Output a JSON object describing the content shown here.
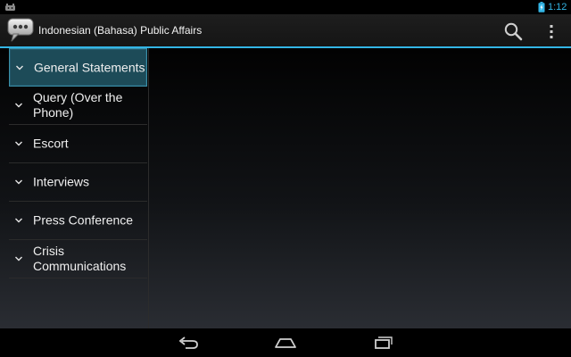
{
  "status_bar": {
    "time": "1:12",
    "icons": [
      "android-notification-icon",
      "battery-charging-icon"
    ],
    "clock_color": "#33b5e5"
  },
  "action_bar": {
    "title": "Indonesian (Bahasa) Public Affairs",
    "app_icon": "speech-bubble-icon",
    "actions": [
      "search-icon",
      "overflow-menu-icon"
    ],
    "accent_color": "#33b5e5"
  },
  "sidebar": {
    "items": [
      {
        "label": "General Statements",
        "selected": true,
        "icon": "chevron-down-icon"
      },
      {
        "label": "Query (Over the Phone)",
        "selected": false,
        "icon": "chevron-down-icon"
      },
      {
        "label": "Escort",
        "selected": false,
        "icon": "chevron-down-icon"
      },
      {
        "label": "Interviews",
        "selected": false,
        "icon": "chevron-down-icon"
      },
      {
        "label": "Press Conference",
        "selected": false,
        "icon": "chevron-down-icon"
      },
      {
        "label": "Crisis Communications",
        "selected": false,
        "icon": "chevron-down-icon"
      }
    ],
    "selected_color": "#1d4b58"
  },
  "nav_bar": {
    "buttons": [
      "back-icon",
      "home-icon",
      "recent-apps-icon"
    ]
  }
}
